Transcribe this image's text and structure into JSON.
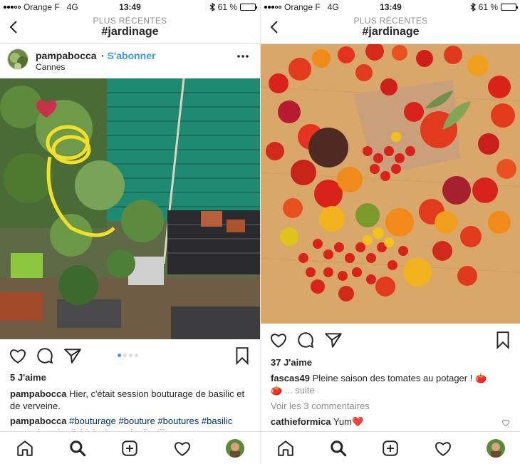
{
  "status": {
    "carrier": "Orange F",
    "network": "4G",
    "time": "13:49",
    "battery": "61 %",
    "battery_level": 0.61
  },
  "header": {
    "subtitle": "PLUS RÉCENTES",
    "title": "#jardinage"
  },
  "post_left": {
    "username": "pampabocca",
    "follow_label": "S'abonner",
    "location": "Cannes",
    "likes": "5 J'aime",
    "carousel_count": 4,
    "carousel_active_index": 0,
    "caption_user": "pampabocca",
    "caption_text": "Hier, c'était session bouturage de basilic et de verveine.",
    "tags_user": "pampabocca",
    "tags_line1": "#bouturage #bouture #boutures",
    "tags_line2": "#basilic #verveine #jardinbiologique #jardinville"
  },
  "post_right": {
    "likes": "37 J'aime",
    "caption_user": "fascas49",
    "caption_text": "Pleine saison des tomates au potager !",
    "caption_emoji": "🍅",
    "caption_emoji2": "🍅",
    "more_label": "... suite",
    "view_comments": "Voir les 3 commentaires",
    "comment_user": "cathieformica",
    "comment_text": "Yum",
    "comment_emoji": "❤️"
  },
  "tabbar": {
    "icons": [
      "home-icon",
      "search-icon",
      "add-icon",
      "activity-heart-icon",
      "profile-avatar"
    ]
  },
  "colors": {
    "link_blue": "#3897f0",
    "hashtag": "#003569",
    "muted": "#8e8e8e",
    "carousel_active": "#3897f0",
    "like_red": "#ed4956"
  }
}
